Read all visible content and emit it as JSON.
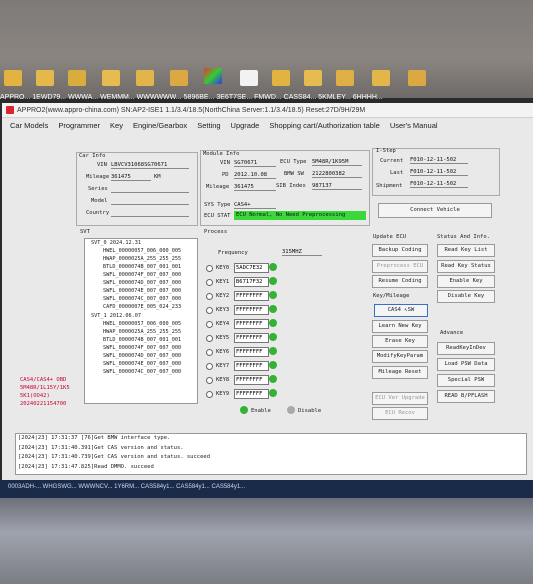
{
  "desktop": {
    "icon_labels": "APPRO... 1EWD79... WWWA... WEMMM... WWWWWW... 5896BE... 3E6T7SE... FMWD... CASS84... 5KMLEY... 6HHHH..."
  },
  "window": {
    "title": "APPRO2(www.appro-china.com)  SN:AP2-ISE1  1.1/3.4/18.5(NorthChina Server:1.1/3.4/18.5)  Reset:27D/9H/29M",
    "menu": [
      "Car Models",
      "Programmer",
      "Key",
      "Engine/Gearbox",
      "Setting",
      "Upgrade",
      "Shopping cart/Authorization table",
      "User's Manual"
    ]
  },
  "car_info": {
    "heading": "Car Info",
    "vin_label": "VIN",
    "vin": "LBVCV31068SG70671",
    "mileage_label": "Mileage",
    "mileage": "361475",
    "mileage_unit": "KM",
    "series_label": "Series",
    "model_label": "Model",
    "country_label": "Country"
  },
  "module_info": {
    "heading": "Module Info",
    "vin_label": "VIN",
    "vin": "SG70671",
    "ecu_type_label": "ECU Type",
    "ecu_type": "5M48R/1K95M",
    "pd_label": "PD",
    "pd": "2012.10.08",
    "bmw_sw_label": "BMW SW",
    "bmw_sw": "2122800382",
    "mileage_label": "Mileage",
    "mileage": "361475",
    "sib_label": "SIB Index",
    "sib": "987137",
    "sys_type_label": "SYS Type",
    "sys_type": "CAS4+",
    "ecu_stat_label": "ECU STAT",
    "ecu_stat": "ECU Normal, No Need Preprocessing"
  },
  "istep": {
    "heading": "I-Step",
    "current_label": "Current",
    "current": "F010-12-11-502",
    "last_label": "Last",
    "last": "F010-12-11-502",
    "shipment_label": "Shipment",
    "shipment": "F010-12-11-502",
    "connect_button": "Connect Vehicle"
  },
  "svt": {
    "heading": "SVT",
    "lines": [
      "SVT_0   2024.12.31",
      "HWEL_00000057_006_000_005",
      "HWAP_0000025A_255_255_255",
      "BTLD_0000074B_007_001_001",
      "SWFL_0000074F_007_007_000",
      "SWFL_0000074D_007_007_000",
      "SWFL_0000074E_007_007_000",
      "SWFL_0000074C_007_007_000",
      "CAFD_0000007E_005_024_233",
      "SVT_1   2012.06.07",
      "HWEL_00000057_006_000_005",
      "HWAP_0000025A_255_255_255",
      "BTLD_0000074B_007_001_001",
      "SWFL_0000074F_007_007_000",
      "SWFL_0000074D_007_007_000",
      "SWFL_0000074E_007_007_000",
      "SWFL_0000074C_007_007_000"
    ],
    "tag_lines": [
      "CAS4/CAS4+ OBD",
      "5M48R/1L15Y/1K5",
      "5K1(OO42)",
      "20240221154700"
    ]
  },
  "process": {
    "heading": "Process",
    "frequency_label": "Frequency",
    "frequency": "315MHZ",
    "keys": [
      {
        "label": "KEY0",
        "value": "5ADC7E32"
      },
      {
        "label": "KEY1",
        "value": "B6717F32"
      },
      {
        "label": "KEY2",
        "value": "FFFFFFFF"
      },
      {
        "label": "KEY3",
        "value": "FFFFFFFF"
      },
      {
        "label": "KEY4",
        "value": "FFFFFFFF"
      },
      {
        "label": "KEY5",
        "value": "FFFFFFFF"
      },
      {
        "label": "KEY6",
        "value": "FFFFFFFF"
      },
      {
        "label": "KEY7",
        "value": "FFFFFFFF"
      },
      {
        "label": "KEY8",
        "value": "FFFFFFFF"
      },
      {
        "label": "KEY9",
        "value": "FFFFFFFF"
      }
    ],
    "enable_label": "Enable",
    "disable_label": "Disable",
    "status_color": "#33b233"
  },
  "update_ecu": {
    "heading": "Update ECU",
    "backup": "Backup Coding",
    "preprocess": "Preprocess ECU",
    "resume": "Resume Coding",
    "ecu_ver": "ECU Ver Upgrade",
    "ecu_recover": "ECU Recov"
  },
  "key_mileage": {
    "heading": "Key/Mileage",
    "cas4": "CAS4 ↖SW",
    "learn": "Learn New Key",
    "erase": "Erase Key",
    "modify": "ModifyKeyParam",
    "mileage_reset": "Mileage Reset"
  },
  "status_info": {
    "heading": "Status And Info.",
    "read_list": "Read Key List",
    "read_status": "Read Key Status",
    "enable": "Enable Key",
    "disable": "Disable Key"
  },
  "advance": {
    "heading": "Advance",
    "read_key_in_dev": "ReadKeyInDev",
    "load_psw": "Load PSW Data",
    "special": "Special PSW",
    "read_bflash": "READ B/PFLASH"
  },
  "log": [
    "[2024|23] 17:31:37 [76]Get BMW interface type.",
    "[2024|23] 17:31:40.391]Get CAS version and status.",
    "[2024|23] 17:31:40.739]Get CAS version and status.  succeed",
    "[2024|23] 17:31:47.825]Read DMMO.  succeed"
  ],
  "taskbar": {
    "text": "0003ADH-...  WHGSWG...  WWWNCV...  1Y6RM...  CAS584y1...  CAS584y1...  CAS584y1..."
  },
  "colors": {
    "status_green": "#3bd83b",
    "window_bg": "#e9e9e9"
  }
}
